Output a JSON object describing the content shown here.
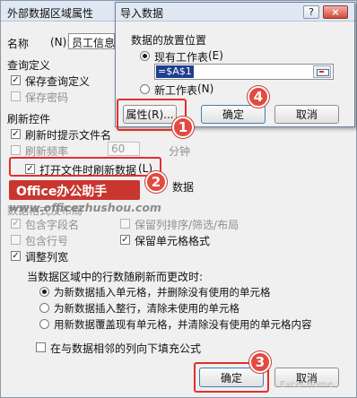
{
  "back_dialog": {
    "title": "外部数据区域属性",
    "name_label": "名称",
    "name_value": "员工信息",
    "query_def_label": "查询定义",
    "save_query_def": "保存查询定义",
    "save_password": "保存密码",
    "refresh_control_label": "刷新控件",
    "refresh_prompt": "刷新时提示文件名",
    "refresh_freq": "刷新频率",
    "refresh_freq_value": "60",
    "minutes": "分钟",
    "open_refresh": "打开文件时刷新数据",
    "open_refresh_key": "(L)",
    "remove_data_tail": "数据",
    "data_format_label": "数据格式及布局",
    "include_field_names": "包含字段名",
    "include_row_numbers": "包含行号",
    "adjust_column_width": "调整列宽",
    "preserve_sort": "保留列排序/筛选/布局",
    "preserve_cell_format": "保留单元格格式",
    "row_change_label": "当数据区域中的行数随刷新而更改时:",
    "option_insert_cells": "为新数据插入单元格，并删除没有使用的单元格",
    "option_insert_rows": "为新数据插入整行，清除未使用的单元格",
    "option_overwrite": "用新数据覆盖现有单元格，并清除没有使用的单元格内容",
    "fill_formulas": "在与数据相邻的列向下填充公式",
    "ok": "确定",
    "cancel": "取消"
  },
  "import_dialog": {
    "title": "导入数据",
    "placement_label": "数据的放置位置",
    "existing_sheet": "现有工作表",
    "existing_sheet_key": "(E)",
    "cell_ref": "=$A$1",
    "new_sheet": "新工作表",
    "new_sheet_key": "(N)",
    "properties": "属性",
    "properties_key": "(R)...",
    "ok": "确定",
    "cancel": "取消"
  },
  "watermark": {
    "brand": "Office办公助手",
    "url": "www.officezhushou.com",
    "corner": "Excel Home"
  },
  "badges": [
    "1",
    "2",
    "3",
    "4"
  ],
  "colors": {
    "annotation_red": "#e0302a",
    "title_bar": "#dfe8f3",
    "dialog_bg": "#f0f0f0"
  }
}
